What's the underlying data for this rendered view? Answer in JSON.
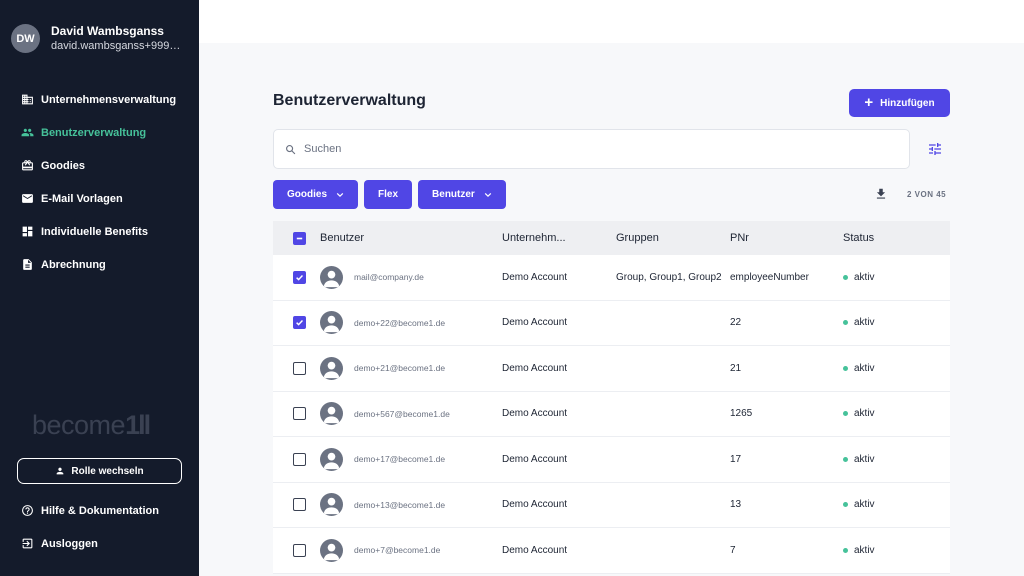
{
  "sidebar": {
    "profile": {
      "initials": "DW",
      "name": "David Wambsganss",
      "email": "david.wambsganss+999@b..."
    },
    "nav": [
      {
        "label": "Unternehmensverwaltung",
        "icon": "building-icon",
        "active": false
      },
      {
        "label": "Benutzerverwaltung",
        "icon": "users-icon",
        "active": true
      },
      {
        "label": "Goodies",
        "icon": "gift-icon",
        "active": false
      },
      {
        "label": "E-Mail Vorlagen",
        "icon": "mail-icon",
        "active": false
      },
      {
        "label": "Individuelle Benefits",
        "icon": "dashboard-icon",
        "active": false
      },
      {
        "label": "Abrechnung",
        "icon": "document-icon",
        "active": false
      }
    ],
    "logo": "become",
    "role_button": "Rolle wechseln",
    "bottom_nav": [
      {
        "label": "Hilfe & Dokumentation",
        "icon": "help-icon"
      },
      {
        "label": "Ausloggen",
        "icon": "logout-icon"
      }
    ]
  },
  "main": {
    "title": "Benutzerverwaltung",
    "add_button": "Hinzufügen",
    "search_placeholder": "Suchen",
    "filters": [
      {
        "label": "Goodies",
        "dropdown": true
      },
      {
        "label": "Flex",
        "dropdown": false
      },
      {
        "label": "Benutzer",
        "dropdown": true
      }
    ],
    "count": "2 VON 45"
  },
  "table": {
    "headers": [
      "Benutzer",
      "Unternehm...",
      "Gruppen",
      "PNr",
      "Status"
    ],
    "rows": [
      {
        "checked": true,
        "email": "mail@company.de",
        "company": "Demo Account",
        "groups": "Group, Group1, Group2",
        "pnr": "employeeNumber",
        "status": "aktiv"
      },
      {
        "checked": true,
        "email": "demo+22@become1.de",
        "company": "Demo Account",
        "groups": "",
        "pnr": "22",
        "status": "aktiv"
      },
      {
        "checked": false,
        "email": "demo+21@become1.de",
        "company": "Demo Account",
        "groups": "",
        "pnr": "21",
        "status": "aktiv"
      },
      {
        "checked": false,
        "email": "demo+567@become1.de",
        "company": "Demo Account",
        "groups": "",
        "pnr": "1265",
        "status": "aktiv"
      },
      {
        "checked": false,
        "email": "demo+17@become1.de",
        "company": "Demo Account",
        "groups": "",
        "pnr": "17",
        "status": "aktiv"
      },
      {
        "checked": false,
        "email": "demo+13@become1.de",
        "company": "Demo Account",
        "groups": "",
        "pnr": "13",
        "status": "aktiv"
      },
      {
        "checked": false,
        "email": "demo+7@become1.de",
        "company": "Demo Account",
        "groups": "",
        "pnr": "7",
        "status": "aktiv"
      }
    ]
  },
  "colors": {
    "sidebar_bg": "#141b2b",
    "accent": "#5046e5",
    "active_nav": "#46c29a",
    "status_active": "#46c29a"
  }
}
